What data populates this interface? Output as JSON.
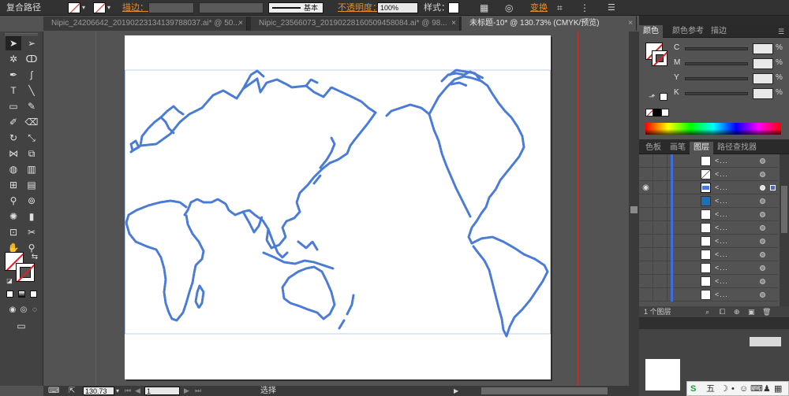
{
  "control_bar": {
    "object_type": "复合路径",
    "stroke_label": "描边：",
    "stroke_style_label": "基本",
    "opacity_label": "不透明度：",
    "opacity_value": "100%",
    "style_label": "样式：",
    "transform_label": "变换"
  },
  "tabs": [
    {
      "label": "Nipic_24206642_20190223134139788037.ai* @ 50..."
    },
    {
      "label": "Nipic_23566073_20190228160509458084.ai* @ 98..."
    },
    {
      "label": "未标题-10* @ 130.73% (CMYK/预览)"
    }
  ],
  "status_bar": {
    "zoom": "130.73",
    "page": "1",
    "tool": "选择"
  },
  "color_panel": {
    "tabs": [
      "颜色",
      "颜色参考",
      "描边"
    ],
    "channels": [
      {
        "name": "C",
        "value": "",
        "unit": "%"
      },
      {
        "name": "M",
        "value": "",
        "unit": "%"
      },
      {
        "name": "Y",
        "value": "",
        "unit": "%"
      },
      {
        "name": "K",
        "value": "",
        "unit": "%"
      }
    ]
  },
  "layers_panel": {
    "tabs": [
      "色板",
      "画笔",
      "图层",
      "路径查找器"
    ],
    "row_label": "<...",
    "footer": "1 个图层"
  },
  "colors": {
    "map_stroke": "#4a7bd6",
    "layer_color": "#3d6edb",
    "stroke_red": "#d22222",
    "orange_accent": "#e88d2a"
  }
}
